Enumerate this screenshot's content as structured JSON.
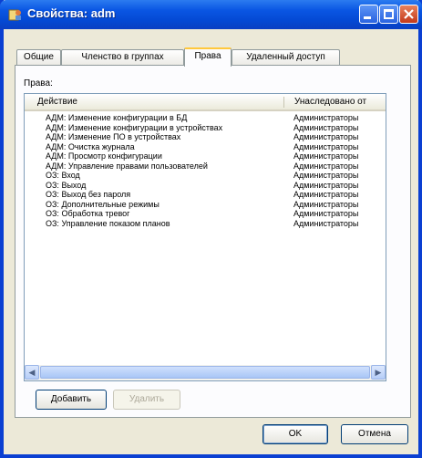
{
  "window": {
    "title": "Свойства: adm",
    "icon": "users-properties-icon"
  },
  "tabs": [
    {
      "label": "Общие",
      "active": false
    },
    {
      "label": "Членство в группах",
      "active": false
    },
    {
      "label": "Права",
      "active": true
    },
    {
      "label": "Удаленный доступ",
      "active": false
    }
  ],
  "rights": {
    "label": "Права:",
    "columns": [
      "Действие",
      "Унаследовано от"
    ],
    "rows": [
      {
        "action": "АДМ: Изменение конфигурации в БД",
        "inherited": "Администраторы"
      },
      {
        "action": "АДМ: Изменение конфигурации в устройствах",
        "inherited": "Администраторы"
      },
      {
        "action": "АДМ: Изменение ПО в устройствах",
        "inherited": "Администраторы"
      },
      {
        "action": "АДМ: Очистка журнала",
        "inherited": "Администраторы"
      },
      {
        "action": "АДМ: Просмотр конфигурации",
        "inherited": "Администраторы"
      },
      {
        "action": "АДМ: Управление правами пользователей",
        "inherited": "Администраторы"
      },
      {
        "action": "ОЗ: Вход",
        "inherited": "Администраторы"
      },
      {
        "action": "ОЗ: Выход",
        "inherited": "Администраторы"
      },
      {
        "action": "ОЗ: Выход без пароля",
        "inherited": "Администраторы"
      },
      {
        "action": "ОЗ: Дополнительные режимы",
        "inherited": "Администраторы"
      },
      {
        "action": "ОЗ: Обработка тревог",
        "inherited": "Администраторы"
      },
      {
        "action": "ОЗ: Управление показом планов",
        "inherited": "Администраторы"
      }
    ]
  },
  "buttons": {
    "add": "Добавить",
    "delete": "Удалить",
    "ok": "OK",
    "cancel": "Отмена"
  }
}
